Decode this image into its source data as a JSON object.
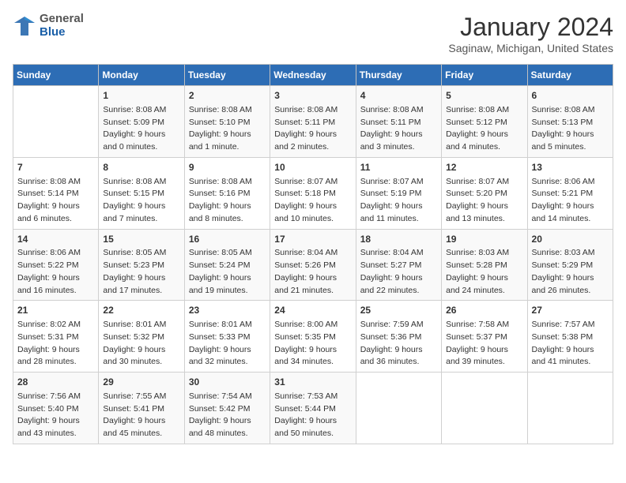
{
  "logo": {
    "general": "General",
    "blue": "Blue"
  },
  "title": "January 2024",
  "subtitle": "Saginaw, Michigan, United States",
  "days_of_week": [
    "Sunday",
    "Monday",
    "Tuesday",
    "Wednesday",
    "Thursday",
    "Friday",
    "Saturday"
  ],
  "weeks": [
    [
      {
        "day": "",
        "sunrise": "",
        "sunset": "",
        "daylight": ""
      },
      {
        "day": "1",
        "sunrise": "Sunrise: 8:08 AM",
        "sunset": "Sunset: 5:09 PM",
        "daylight": "Daylight: 9 hours and 0 minutes."
      },
      {
        "day": "2",
        "sunrise": "Sunrise: 8:08 AM",
        "sunset": "Sunset: 5:10 PM",
        "daylight": "Daylight: 9 hours and 1 minute."
      },
      {
        "day": "3",
        "sunrise": "Sunrise: 8:08 AM",
        "sunset": "Sunset: 5:11 PM",
        "daylight": "Daylight: 9 hours and 2 minutes."
      },
      {
        "day": "4",
        "sunrise": "Sunrise: 8:08 AM",
        "sunset": "Sunset: 5:11 PM",
        "daylight": "Daylight: 9 hours and 3 minutes."
      },
      {
        "day": "5",
        "sunrise": "Sunrise: 8:08 AM",
        "sunset": "Sunset: 5:12 PM",
        "daylight": "Daylight: 9 hours and 4 minutes."
      },
      {
        "day": "6",
        "sunrise": "Sunrise: 8:08 AM",
        "sunset": "Sunset: 5:13 PM",
        "daylight": "Daylight: 9 hours and 5 minutes."
      }
    ],
    [
      {
        "day": "7",
        "sunrise": "Sunrise: 8:08 AM",
        "sunset": "Sunset: 5:14 PM",
        "daylight": "Daylight: 9 hours and 6 minutes."
      },
      {
        "day": "8",
        "sunrise": "Sunrise: 8:08 AM",
        "sunset": "Sunset: 5:15 PM",
        "daylight": "Daylight: 9 hours and 7 minutes."
      },
      {
        "day": "9",
        "sunrise": "Sunrise: 8:08 AM",
        "sunset": "Sunset: 5:16 PM",
        "daylight": "Daylight: 9 hours and 8 minutes."
      },
      {
        "day": "10",
        "sunrise": "Sunrise: 8:07 AM",
        "sunset": "Sunset: 5:18 PM",
        "daylight": "Daylight: 9 hours and 10 minutes."
      },
      {
        "day": "11",
        "sunrise": "Sunrise: 8:07 AM",
        "sunset": "Sunset: 5:19 PM",
        "daylight": "Daylight: 9 hours and 11 minutes."
      },
      {
        "day": "12",
        "sunrise": "Sunrise: 8:07 AM",
        "sunset": "Sunset: 5:20 PM",
        "daylight": "Daylight: 9 hours and 13 minutes."
      },
      {
        "day": "13",
        "sunrise": "Sunrise: 8:06 AM",
        "sunset": "Sunset: 5:21 PM",
        "daylight": "Daylight: 9 hours and 14 minutes."
      }
    ],
    [
      {
        "day": "14",
        "sunrise": "Sunrise: 8:06 AM",
        "sunset": "Sunset: 5:22 PM",
        "daylight": "Daylight: 9 hours and 16 minutes."
      },
      {
        "day": "15",
        "sunrise": "Sunrise: 8:05 AM",
        "sunset": "Sunset: 5:23 PM",
        "daylight": "Daylight: 9 hours and 17 minutes."
      },
      {
        "day": "16",
        "sunrise": "Sunrise: 8:05 AM",
        "sunset": "Sunset: 5:24 PM",
        "daylight": "Daylight: 9 hours and 19 minutes."
      },
      {
        "day": "17",
        "sunrise": "Sunrise: 8:04 AM",
        "sunset": "Sunset: 5:26 PM",
        "daylight": "Daylight: 9 hours and 21 minutes."
      },
      {
        "day": "18",
        "sunrise": "Sunrise: 8:04 AM",
        "sunset": "Sunset: 5:27 PM",
        "daylight": "Daylight: 9 hours and 22 minutes."
      },
      {
        "day": "19",
        "sunrise": "Sunrise: 8:03 AM",
        "sunset": "Sunset: 5:28 PM",
        "daylight": "Daylight: 9 hours and 24 minutes."
      },
      {
        "day": "20",
        "sunrise": "Sunrise: 8:03 AM",
        "sunset": "Sunset: 5:29 PM",
        "daylight": "Daylight: 9 hours and 26 minutes."
      }
    ],
    [
      {
        "day": "21",
        "sunrise": "Sunrise: 8:02 AM",
        "sunset": "Sunset: 5:31 PM",
        "daylight": "Daylight: 9 hours and 28 minutes."
      },
      {
        "day": "22",
        "sunrise": "Sunrise: 8:01 AM",
        "sunset": "Sunset: 5:32 PM",
        "daylight": "Daylight: 9 hours and 30 minutes."
      },
      {
        "day": "23",
        "sunrise": "Sunrise: 8:01 AM",
        "sunset": "Sunset: 5:33 PM",
        "daylight": "Daylight: 9 hours and 32 minutes."
      },
      {
        "day": "24",
        "sunrise": "Sunrise: 8:00 AM",
        "sunset": "Sunset: 5:35 PM",
        "daylight": "Daylight: 9 hours and 34 minutes."
      },
      {
        "day": "25",
        "sunrise": "Sunrise: 7:59 AM",
        "sunset": "Sunset: 5:36 PM",
        "daylight": "Daylight: 9 hours and 36 minutes."
      },
      {
        "day": "26",
        "sunrise": "Sunrise: 7:58 AM",
        "sunset": "Sunset: 5:37 PM",
        "daylight": "Daylight: 9 hours and 39 minutes."
      },
      {
        "day": "27",
        "sunrise": "Sunrise: 7:57 AM",
        "sunset": "Sunset: 5:38 PM",
        "daylight": "Daylight: 9 hours and 41 minutes."
      }
    ],
    [
      {
        "day": "28",
        "sunrise": "Sunrise: 7:56 AM",
        "sunset": "Sunset: 5:40 PM",
        "daylight": "Daylight: 9 hours and 43 minutes."
      },
      {
        "day": "29",
        "sunrise": "Sunrise: 7:55 AM",
        "sunset": "Sunset: 5:41 PM",
        "daylight": "Daylight: 9 hours and 45 minutes."
      },
      {
        "day": "30",
        "sunrise": "Sunrise: 7:54 AM",
        "sunset": "Sunset: 5:42 PM",
        "daylight": "Daylight: 9 hours and 48 minutes."
      },
      {
        "day": "31",
        "sunrise": "Sunrise: 7:53 AM",
        "sunset": "Sunset: 5:44 PM",
        "daylight": "Daylight: 9 hours and 50 minutes."
      },
      {
        "day": "",
        "sunrise": "",
        "sunset": "",
        "daylight": ""
      },
      {
        "day": "",
        "sunrise": "",
        "sunset": "",
        "daylight": ""
      },
      {
        "day": "",
        "sunrise": "",
        "sunset": "",
        "daylight": ""
      }
    ]
  ]
}
